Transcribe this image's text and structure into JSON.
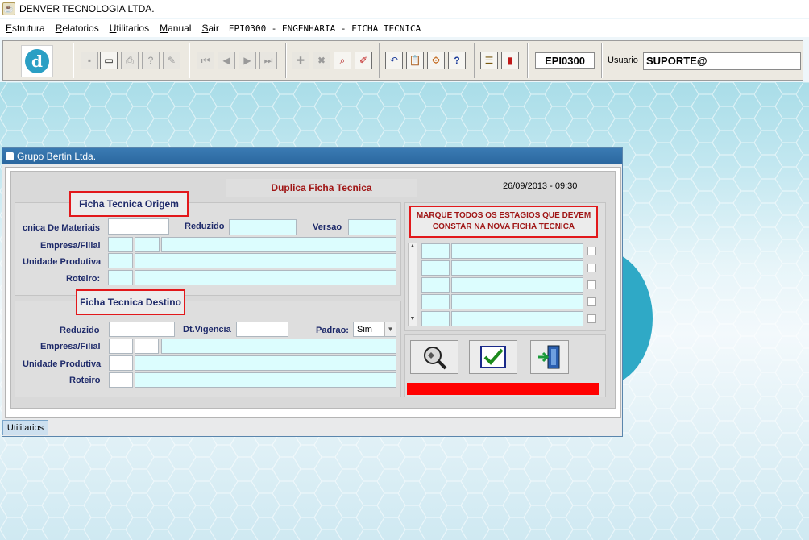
{
  "app": {
    "title": "DENVER TECNOLOGIA LTDA."
  },
  "menu": {
    "items": [
      {
        "underlined": "E",
        "rest": "strutura"
      },
      {
        "underlined": "R",
        "rest": "elatorios"
      },
      {
        "underlined": "U",
        "rest": "tilitarios"
      },
      {
        "underlined": "M",
        "rest": "anual"
      },
      {
        "underlined": "S",
        "rest": "air"
      }
    ],
    "form_title": "EPI0300 - ENGENHARIA - FICHA TECNICA"
  },
  "toolbar": {
    "form_code": "EPI0300",
    "user_label": "Usuario",
    "user_value": "SUPORTE@"
  },
  "window": {
    "title": "Grupo Bertin Ltda.",
    "heading": "Duplica Ficha Tecnica",
    "datetime": "26/09/2013 - 09:30",
    "tab": "Utilitarios"
  },
  "origem": {
    "title": "Ficha Tecnica Origem",
    "ficha_label": "cnica De Materiais",
    "reduzido_label": "Reduzido",
    "versao_label": "Versao",
    "empresa_label": "Empresa/Filial",
    "unidade_label": "Unidade Produtiva",
    "roteiro_label": "Roteiro:"
  },
  "destino": {
    "title": "Ficha Tecnica Destino",
    "reduzido_label": "Reduzido",
    "vigencia_label": "Dt.Vigencia",
    "padrao_label": "Padrao:",
    "padrao_value": "Sim",
    "empresa_label": "Empresa/Filial",
    "unidade_label": "Unidade Produtiva",
    "roteiro_label": "Roteiro"
  },
  "estagios": {
    "instruction": "MARQUE TODOS OS ESTAGIOS QUE DEVEM CONSTAR NA NOVA FICHA TECNICA"
  },
  "colors": {
    "accent": "#e2181b",
    "field": "#dcfdfe",
    "title_bar": "#2a679f",
    "label": "#1e2a6a"
  }
}
